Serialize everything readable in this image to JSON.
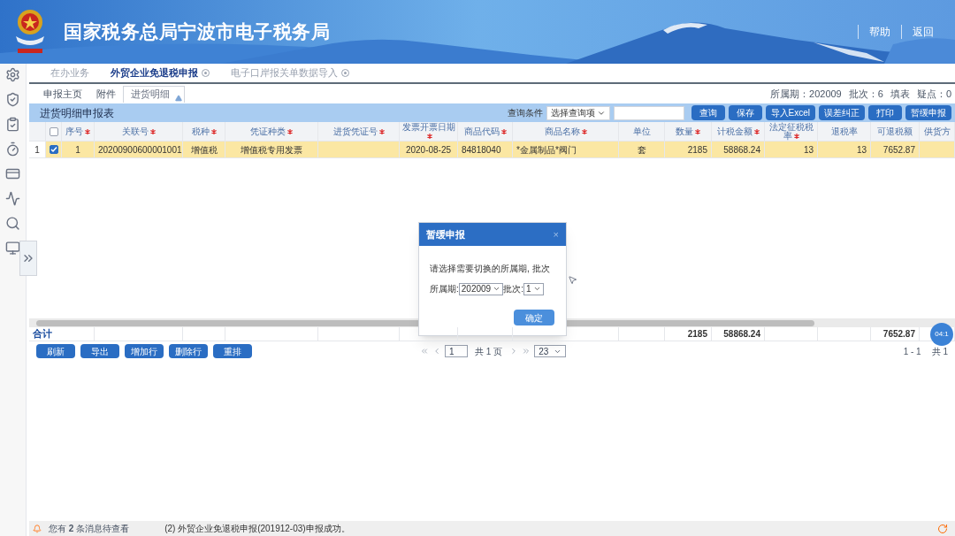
{
  "header": {
    "title": "国家税务总局宁波市电子税务局",
    "links": [
      "帮助",
      "返回"
    ]
  },
  "tabs": [
    {
      "label": "在办业务",
      "selected": false,
      "closable": false
    },
    {
      "label": "外贸企业免退税申报",
      "selected": true,
      "closable": true
    },
    {
      "label": "电子口岸报关单数据导入",
      "selected": false,
      "closable": true
    }
  ],
  "subtabs": [
    {
      "label": "申报主页",
      "selected": false
    },
    {
      "label": "附件",
      "selected": false
    },
    {
      "label": "进货明细",
      "selected": true
    }
  ],
  "period_info": [
    "所属期：202009",
    "批次：6",
    "填表",
    "疑点：0"
  ],
  "table": {
    "title": "进货明细申报表",
    "query_label": "查询条件",
    "query_select": "选择查询项",
    "buttons": [
      "查询",
      "保存",
      "导入Excel",
      "误差纠正",
      "打印",
      "暂缓申报"
    ],
    "all_checked": false,
    "columns": [
      {
        "label": "序号",
        "required": true
      },
      {
        "label": "关联号",
        "required": true
      },
      {
        "label": "税种",
        "required": true
      },
      {
        "label": "凭证种类",
        "required": true
      },
      {
        "label": "进货凭证号",
        "required": true
      },
      {
        "label": "发票开票日期",
        "required": true
      },
      {
        "label": "商品代码",
        "required": true
      },
      {
        "label": "商品名称",
        "required": true
      },
      {
        "label": "单位",
        "required": false
      },
      {
        "label": "数量",
        "required": true
      },
      {
        "label": "计税金额",
        "required": true
      },
      {
        "label": "法定征税税率",
        "required": true
      },
      {
        "label": "退税率",
        "required": false
      },
      {
        "label": "可退税额",
        "required": false
      },
      {
        "label": "供货方",
        "required": false
      }
    ],
    "rows": [
      {
        "row_number": "1",
        "checked": true,
        "selected": true,
        "cells": [
          "1",
          "20200900600001001",
          "增值税",
          "增值税专用发票",
          null,
          "2020-08-25",
          "84818040",
          "*金属制品*阀门",
          "套",
          "2185",
          "58868.24",
          "13",
          "13",
          "7652.87",
          null
        ]
      }
    ],
    "totals": {
      "label": "合计",
      "cells": [
        null,
        null,
        null,
        null,
        null,
        null,
        null,
        null,
        null,
        "2185",
        "58868.24",
        null,
        null,
        "7652.87",
        null
      ]
    }
  },
  "toolbar": [
    "刷新",
    "导出",
    "增加行",
    "删除行",
    "重排"
  ],
  "pagination": {
    "page": "1",
    "pages": "共 1 页",
    "page_size": "23",
    "range": "1 - 1",
    "total": "共 1"
  },
  "time_badge": "04:1",
  "dialog": {
    "title": "暂缓申报",
    "close": "×",
    "message": "请选择需要切换的所属期, 批次",
    "period_label": "所属期:",
    "period_value": "202009",
    "batch_label": "批次:",
    "batch_value": "1",
    "ok": "确定"
  },
  "status_bar": {
    "notice": "您有 **2** 条消息待查看",
    "message": "(2) 外贸企业免退税申报(201912-03)申报成功。"
  }
}
